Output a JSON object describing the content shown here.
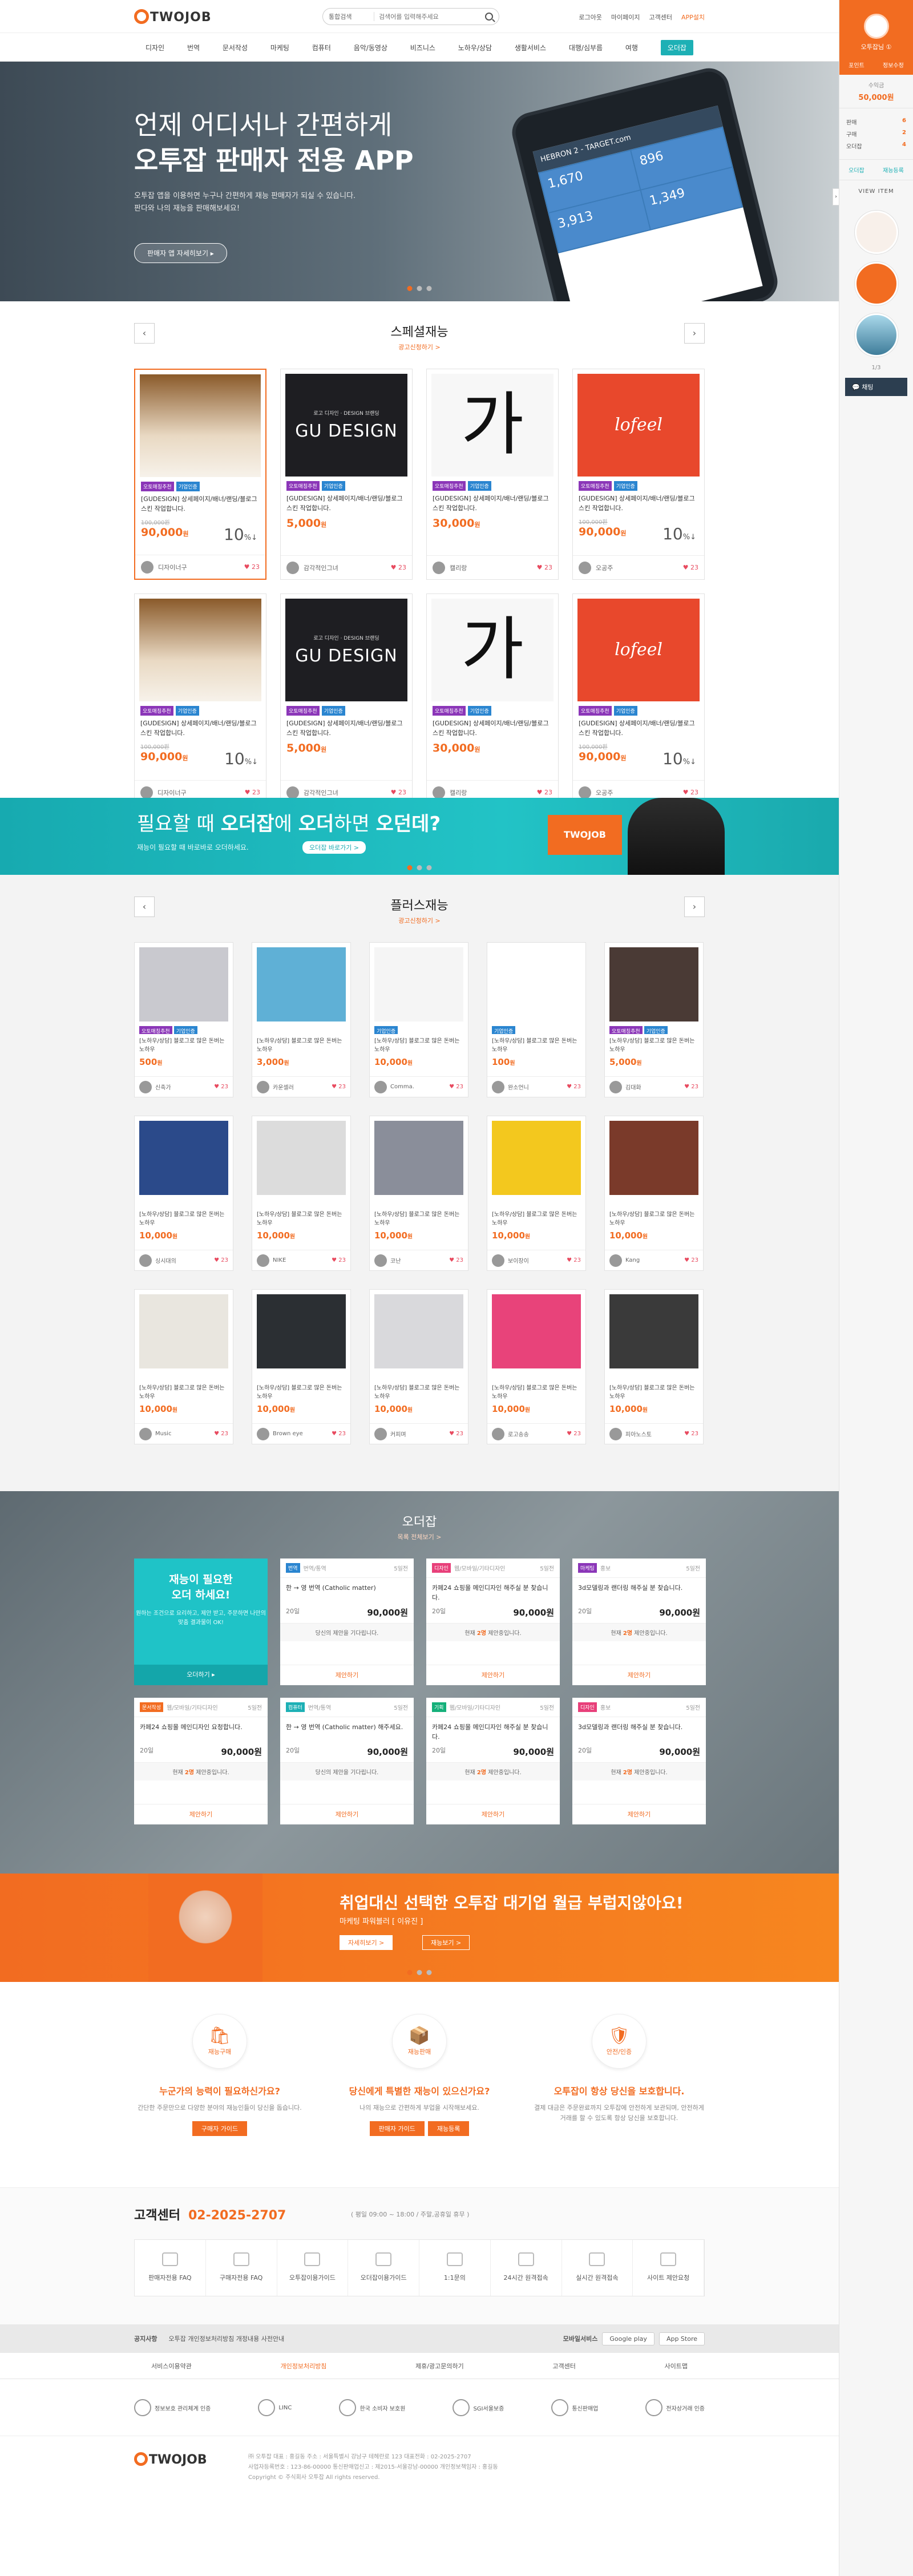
{
  "header": {
    "logo": "TWOJOB",
    "search": {
      "scope": "통합검색",
      "placeholder": "검색어를 입력해주세요"
    },
    "util": [
      "로그아웃",
      "마이페이지",
      "고객센터",
      "APP설치"
    ]
  },
  "gnb": {
    "items": [
      "디자인",
      "번역",
      "문서작성",
      "마케팅",
      "컴퓨터",
      "음악/동영상",
      "비즈니스",
      "노하우/상담",
      "생활서비스",
      "대행/심부름",
      "여행"
    ],
    "cta": "오더잡"
  },
  "hero": {
    "title_1": "언제 어디서나 간편하게",
    "title_2": "오투잡 판매자 전용 APP",
    "desc_1": "오투잡 앱을 이용하면 누구나 간편하게 재능 판매자가 되실 수 있습니다.",
    "desc_2": "판다와 나의 재능을 판매해보세요!",
    "button": "판매자 앱 자세히보기 ▸",
    "phone_bar": "HEBRON 2 - TARGET.com",
    "phone_tiles": [
      "1,670",
      "896",
      "3,913",
      "1,349"
    ]
  },
  "special": {
    "title": "스페셜재능",
    "more": "광고신청하기 >",
    "cards": [
      {
        "tags": [
          "오토매칭추천",
          "기업인증"
        ],
        "title": "[GUDESIGN] 상세페이지/배너/랜딩/블로그스킨 작업합니다.",
        "old": "100,000원",
        "price": "90,000",
        "unit": "원",
        "pct": "10",
        "seller": "디자이너구",
        "likes": "23",
        "selected": true,
        "thumb": "bottles"
      },
      {
        "tags": [
          "오토매칭추천",
          "기업인증"
        ],
        "title": "[GUDESIGN] 상세페이지/배너/랜딩/블로그스킨 작업합니다.",
        "old": "",
        "price": "5,000",
        "unit": "원",
        "pct": "",
        "seller": "감각적인그녀",
        "likes": "23",
        "selected": false,
        "thumb": "gudesign"
      },
      {
        "tags": [
          "오토매칭추천",
          "기업인증"
        ],
        "title": "[GUDESIGN] 상세페이지/배너/랜딩/블로그스킨 작업합니다.",
        "old": "",
        "price": "30,000",
        "unit": "원",
        "pct": "",
        "seller": "캘리랑",
        "likes": "23",
        "selected": false,
        "thumb": "calli"
      },
      {
        "tags": [
          "오토매칭추천",
          "기업인증"
        ],
        "title": "[GUDESIGN] 상세페이지/배너/랜딩/블로그스킨 작업합니다.",
        "old": "100,000원",
        "price": "90,000",
        "unit": "원",
        "pct": "10",
        "seller": "오공주",
        "likes": "23",
        "selected": false,
        "thumb": "lofeel"
      },
      {
        "tags": [
          "오토매칭추천",
          "기업인증"
        ],
        "title": "[GUDESIGN] 상세페이지/배너/랜딩/블로그스킨 작업합니다.",
        "old": "100,000원",
        "price": "90,000",
        "unit": "원",
        "pct": "10",
        "seller": "디자이너구",
        "likes": "23",
        "selected": false,
        "thumb": "bottles"
      },
      {
        "tags": [
          "오토매칭추천",
          "기업인증"
        ],
        "title": "[GUDESIGN] 상세페이지/배너/랜딩/블로그스킨 작업합니다.",
        "old": "",
        "price": "5,000",
        "unit": "원",
        "pct": "",
        "seller": "감각적인그녀",
        "likes": "23",
        "selected": false,
        "thumb": "gudesign"
      },
      {
        "tags": [
          "오토매칭추천",
          "기업인증"
        ],
        "title": "[GUDESIGN] 상세페이지/배너/랜딩/블로그스킨 작업합니다.",
        "old": "",
        "price": "30,000",
        "unit": "원",
        "pct": "",
        "seller": "캘리랑",
        "likes": "23",
        "selected": false,
        "thumb": "calli"
      },
      {
        "tags": [
          "오토매칭추천",
          "기업인증"
        ],
        "title": "[GUDESIGN] 상세페이지/배너/랜딩/블로그스킨 작업합니다.",
        "old": "100,000원",
        "price": "90,000",
        "unit": "원",
        "pct": "10",
        "seller": "오공주",
        "likes": "23",
        "selected": false,
        "thumb": "lofeel"
      }
    ],
    "gudesign_sub": "로고 디자인 · DESIGN 브랜딩",
    "gudesign_main": "GU DESIGN",
    "calli_glyph": "가",
    "lofeel": "lofeel"
  },
  "banner2": {
    "title_pre": "필요할 때 ",
    "title_b1": "오더잡",
    "title_mid": "에 ",
    "title_b2": "오더",
    "title_mid2": "하면 ",
    "title_b3": "오던데?",
    "desc": "재능이 필요할 때 바로바로 오더하세요.",
    "button": "오더잡 바로가기 >",
    "badge": "TWOJOB"
  },
  "plus": {
    "title": "플러스재능",
    "more": "광고신청하기 >",
    "cards": [
      {
        "tags": [
          "오토매칭추천",
          "기업인증"
        ],
        "title": "[노하우/상담] 블로그로 많은 돈버는 노하우",
        "price": "500",
        "seller": "신축가",
        "likes": "23",
        "thumb": "#c9c9cf"
      },
      {
        "tags": [],
        "title": "[노하우/상담] 블로그로 많은 돈버는 노하우",
        "price": "3,000",
        "seller": "카운셀러",
        "likes": "23",
        "thumb": "#5fb0d6"
      },
      {
        "tags": [
          "기업인증"
        ],
        "title": "[노하우/상담] 블로그로 많은 돈버는 노하우",
        "price": "10,000",
        "seller": "Comma.",
        "likes": "23",
        "thumb": "#f5f5f5"
      },
      {
        "tags": [
          "기업인증"
        ],
        "title": "[노하우/상담] 블로그로 많은 돈버는 노하우",
        "price": "100",
        "seller": "완소언니",
        "likes": "23",
        "thumb": "#ffffff"
      },
      {
        "tags": [
          "오토매칭추천",
          "기업인증"
        ],
        "title": "[노하우/상담] 블로그로 많은 돈버는 노하우",
        "price": "5,000",
        "seller": "김대화",
        "likes": "23",
        "thumb": "#4a3a35"
      },
      {
        "tags": [],
        "title": "[노하우/상담] 블로그로 많은 돈버는 노하우",
        "price": "10,000",
        "seller": "싱시대의",
        "likes": "23",
        "thumb": "#2b4a8a"
      },
      {
        "tags": [],
        "title": "[노하우/상담] 블로그로 많은 돈버는 노하우",
        "price": "10,000",
        "seller": "NIKE",
        "likes": "23",
        "thumb": "#dcdcdc"
      },
      {
        "tags": [],
        "title": "[노하우/상담] 블로그로 많은 돈버는 노하우",
        "price": "10,000",
        "seller": "코난",
        "likes": "23",
        "thumb": "#8a8e9a"
      },
      {
        "tags": [],
        "title": "[노하우/상담] 블로그로 많은 돈버는 노하우",
        "price": "10,000",
        "seller": "보이장이",
        "likes": "23",
        "thumb": "#f3c81e"
      },
      {
        "tags": [],
        "title": "[노하우/상담] 블로그로 많은 돈버는 노하우",
        "price": "10,000",
        "seller": "Kang",
        "likes": "23",
        "thumb": "#7a3a2a"
      },
      {
        "tags": [],
        "title": "[노하우/상담] 블로그로 많은 돈버는 노하우",
        "price": "10,000",
        "seller": "Music",
        "likes": "23",
        "thumb": "#e9e6df"
      },
      {
        "tags": [],
        "title": "[노하우/상담] 블로그로 많은 돈버는 노하우",
        "price": "10,000",
        "seller": "Brown eye",
        "likes": "23",
        "thumb": "#2b2f33"
      },
      {
        "tags": [],
        "title": "[노하우/상담] 블로그로 많은 돈버는 노하우",
        "price": "10,000",
        "seller": "커피며",
        "likes": "23",
        "thumb": "#d9d9dc"
      },
      {
        "tags": [],
        "title": "[노하우/상담] 블로그로 많은 돈버는 노하우",
        "price": "10,000",
        "seller": "로고송송",
        "likes": "23",
        "thumb": "#e8437a"
      },
      {
        "tags": [],
        "title": "[노하우/상담] 블로그로 많은 돈버는 노하우",
        "price": "10,000",
        "seller": "피아노스토",
        "likes": "23",
        "thumb": "#3a3a3a"
      }
    ],
    "price_unit": "원"
  },
  "order": {
    "title": "오더잡",
    "more": "목록 전체보기 >",
    "cta": {
      "line1": "재능이 필요한",
      "line2": "오더 하세요!",
      "desc": "원하는 조건으로 요리하고, 제안 받고, 주문하면 나만의 맞춤 결과물이 OK!",
      "button": "오더하기 ▸"
    },
    "cards": [
      {
        "cat": "번역",
        "sub": "번역/통역",
        "date": "5일전",
        "title": "한 → 영 번역 (Catholic matter)",
        "days": "20일",
        "amount": "90,000원",
        "note_pre": "당신의 제안을 기다립니다.",
        "count": "",
        "button": "제안하기"
      },
      {
        "cat": "디자인",
        "sub": "웹/모바일/기타디자인",
        "date": "5일전",
        "title": "카페24 쇼핑몰 메인디자인 해주실 분 찾습니다.",
        "days": "20일",
        "amount": "90,000원",
        "note_pre": "현재 ",
        "count": "2명",
        "button": "제안하기"
      },
      {
        "cat": "마케팅",
        "sub": "홍보",
        "date": "5일전",
        "title": "3d모델링과 랜더링 해주실 분 찾습니다.",
        "days": "20일",
        "amount": "90,000원",
        "note_pre": "현재 ",
        "count": "2명",
        "button": "제안하기"
      },
      {
        "cat": "문서작성",
        "sub": "웹/모바일/기타디자인",
        "date": "5일전",
        "title": "카페24 쇼핑몰 메인디자인 요청합니다.",
        "days": "20일",
        "amount": "90,000원",
        "note_pre": "현재 ",
        "count": "2명",
        "button": "제안하기"
      },
      {
        "cat": "컴퓨터",
        "sub": "번역/통역",
        "date": "5일전",
        "title": "한 → 영 번역 (Catholic matter) 해주세요.",
        "days": "20일",
        "amount": "90,000원",
        "note_pre": "당신의 제안을 기다립니다.",
        "count": "",
        "button": "제안하기"
      },
      {
        "cat": "기획",
        "sub": "웹/모바일/기타디자인",
        "date": "5일전",
        "title": "카페24 쇼핑몰 메인디자인 해주실 분 찾습니다.",
        "days": "20일",
        "amount": "90,000원",
        "note_pre": "현재 ",
        "count": "2명",
        "button": "제안하기"
      },
      {
        "cat": "디자인",
        "sub": "홍보",
        "date": "5일전",
        "title": "3d모델링과 랜더링 해주실 분 찾습니다.",
        "days": "20일",
        "amount": "90,000원",
        "note_pre": "현재 ",
        "count": "2명",
        "button": "제안하기"
      }
    ],
    "note_post": " 제안중입니다."
  },
  "banner3": {
    "title": "취업대신 선택한 오투잡 대기업 월급 부럽지않아요!",
    "desc": "마케팅 파워블러 [ 이유진 ]",
    "btn1": "자세히보기 >",
    "btn2": "재능보기 >"
  },
  "guide": [
    {
      "label": "재능구매",
      "icon": "🛍",
      "title": "누군가의 능력이 필요하신가요?",
      "desc": "간단한 주문만으로 다양한 분야의 재능인들이 당신을 돕습니다.",
      "buttons": [
        "구매자 가이드"
      ]
    },
    {
      "label": "재능판매",
      "icon": "📦",
      "title": "당신에게 특별한 재능이 있으신가요?",
      "desc": "나의 재능으로 간편하게 부업을 시작해보세요.",
      "buttons": [
        "판매자 가이드",
        "재능등록"
      ]
    },
    {
      "label": "안전/인증",
      "icon": "🛡",
      "title": "오투잡이 항상 당신을 보호합니다.",
      "desc": "결제 대금은 주문완료까지 오투잡에 안전하게 보관되며, 안전하게 거래를 할 수 있도록 항상 당신을 보호합니다.",
      "buttons": []
    }
  ],
  "cs": {
    "title": "고객센터",
    "phone": "02-2025-2707",
    "hours": "( 평일 09:00 ~ 18:00 / 주말,공휴일 휴무 )",
    "links": [
      "판매자전용 FAQ",
      "구매자전용 FAQ",
      "오투잡이용가이드",
      "오더잡이용가이드",
      "1:1문의",
      "24시간 원격접속",
      "실시간 원격접속",
      "사이트 제안요청"
    ]
  },
  "notice": {
    "label": "공지사항",
    "text": "오투잡 개인정보처리방침 개정내용 사전안내",
    "mobile": "모바일서비스",
    "stores": [
      "Google play",
      "App Store"
    ]
  },
  "footmenu": [
    "서비스이용약관",
    "개인정보처리방침",
    "제휴/광고문의하기",
    "고객센터",
    "사이트맵"
  ],
  "certs": [
    "정보보호 관리체계 인증",
    "LINC",
    "한국 소비자 보호원",
    "SGI서울보증",
    "통신판매업",
    "전자상거래 인증"
  ],
  "footer": {
    "logo": "TWOJOB",
    "line1": "㈜ 오투잡 대표 : 홍길동   주소 : 서울특별시 강남구 테헤란로 123   대표전화 : 02-2025-2707",
    "line2": "사업자등록번호 : 123-86-00000   통신판매업신고 : 제2015-서울강남-00000   개인정보책임자 : 홍길동",
    "line3": "Copyright © 주식회사 오투잡 All rights reserved."
  },
  "sidebar": {
    "user": "오투잡님 ①",
    "mini": [
      "포인트",
      "정보수정"
    ],
    "cash_label": "수익금",
    "cash": "50,000원",
    "stats": [
      {
        "k": "판매",
        "v": "6"
      },
      {
        "k": "구매",
        "v": "2"
      },
      {
        "k": "오더잡",
        "v": "4"
      }
    ],
    "links": [
      "오더잡",
      "재능등록"
    ],
    "view": "VIEW ITEM",
    "page": "1/3",
    "chat": "채팅"
  }
}
